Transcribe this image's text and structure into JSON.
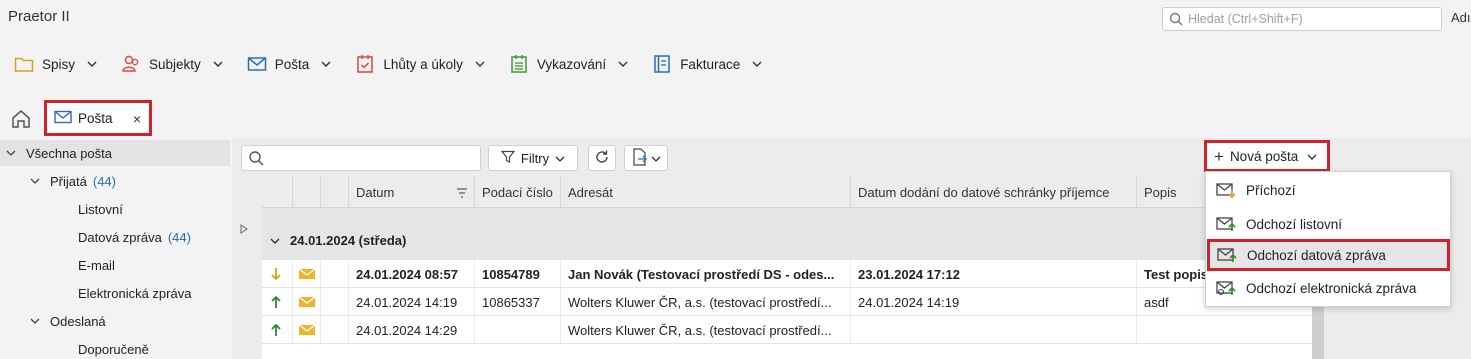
{
  "app": {
    "title": "Praetor II",
    "search_placeholder": "Hledat (Ctrl+Shift+F)",
    "user_label": "Adı"
  },
  "menu": {
    "items": [
      {
        "label": "Spisy",
        "icon": "folder-icon",
        "color": "#d8a21c"
      },
      {
        "label": "Subjekty",
        "icon": "people-icon",
        "color": "#d9483b"
      },
      {
        "label": "Pošta",
        "icon": "envelope-icon",
        "color": "#2b6db8"
      },
      {
        "label": "Lhůty a úkoly",
        "icon": "calendar-check-icon",
        "color": "#d9483b"
      },
      {
        "label": "Vykazování",
        "icon": "timesheet-icon",
        "color": "#3a9a3a"
      },
      {
        "label": "Fakturace",
        "icon": "invoice-icon",
        "color": "#2b6db8"
      }
    ]
  },
  "tabs": {
    "home_icon": "home-icon",
    "active_tab": {
      "label": "Pošta",
      "icon": "envelope-icon",
      "close": "×"
    }
  },
  "sidebar": {
    "items": [
      {
        "label": "Všechna pošta",
        "count": ""
      },
      {
        "label": "Přijatá",
        "count": "(44)"
      },
      {
        "label": "Listovní",
        "count": ""
      },
      {
        "label": "Datová zpráva",
        "count": "(44)"
      },
      {
        "label": "E-mail",
        "count": ""
      },
      {
        "label": "Elektronická zpráva",
        "count": ""
      },
      {
        "label": "Odeslaná",
        "count": ""
      },
      {
        "label": "Doporučeně",
        "count": ""
      }
    ]
  },
  "toolbar": {
    "search_placeholder": "",
    "filter_label": "Filtry",
    "new_post_label": "Nová pošta"
  },
  "grid": {
    "columns": [
      "Datum",
      "Podací číslo",
      "Adresát",
      "Datum dodání do datové schránky příjemce",
      "Popis"
    ],
    "group_label": "24.01.2024 (středa)",
    "rows": [
      {
        "direction": "incoming",
        "date": "24.01.2024 08:57",
        "number": "10854789",
        "addressee": "Jan Novák (Testovací prostředí DS - odes...",
        "delivered": "23.01.2024 17:12",
        "description": "Test popis",
        "unread": true
      },
      {
        "direction": "outgoing",
        "date": "24.01.2024 14:19",
        "number": "10865337",
        "addressee": "Wolters Kluwer ČR, a.s. (testovací prostředí...",
        "delivered": "24.01.2024 14:19",
        "description": "asdf",
        "unread": false
      },
      {
        "direction": "outgoing",
        "date": "24.01.2024 14:29",
        "number": "",
        "addressee": "Wolters Kluwer ČR, a.s. (testovací prostředí...",
        "delivered": "",
        "description": "",
        "unread": false
      }
    ],
    "colors": {
      "incoming_arrow": "#e0a010",
      "outgoing_arrow": "#2e8b2e",
      "envelope": "#f0b428"
    }
  },
  "new_post_menu": {
    "items": [
      {
        "label": "Příchozí",
        "icon": "incoming-mail-icon"
      },
      {
        "label": "Odchozí listovní",
        "icon": "outgoing-letter-icon"
      },
      {
        "label": "Odchozí datová zpráva",
        "icon": "outgoing-data-message-icon"
      },
      {
        "label": "Odchozí elektronická zpráva",
        "icon": "outgoing-electronic-message-icon"
      }
    ]
  },
  "highlight_color": "#d22128"
}
